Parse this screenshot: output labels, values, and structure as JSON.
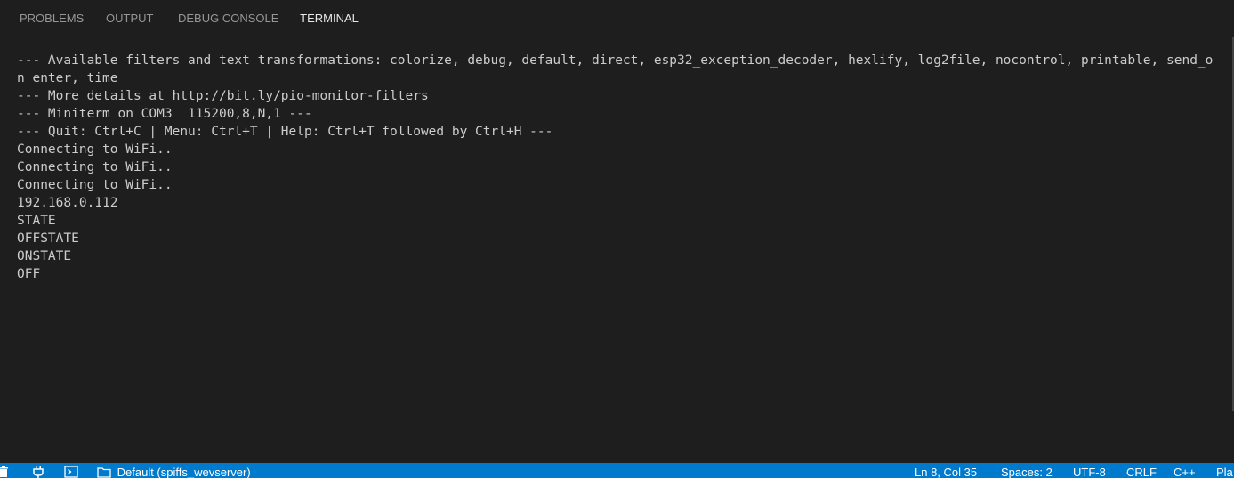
{
  "panel": {
    "tabs": [
      {
        "label": "PROBLEMS",
        "active": false
      },
      {
        "label": "OUTPUT",
        "active": false
      },
      {
        "label": "DEBUG CONSOLE",
        "active": false
      },
      {
        "label": "TERMINAL",
        "active": true
      }
    ]
  },
  "terminal": {
    "lines": [
      "--- Available filters and text transformations: colorize, debug, default, direct, esp32_exception_decoder, hexlify, log2file, nocontrol, printable, send_on_enter, time",
      "--- More details at http://bit.ly/pio-monitor-filters",
      "--- Miniterm on COM3  115200,8,N,1 ---",
      "--- Quit: Ctrl+C | Menu: Ctrl+T | Help: Ctrl+T followed by Ctrl+H ---",
      "Connecting to WiFi..",
      "Connecting to WiFi..",
      "Connecting to WiFi..",
      "192.168.0.112",
      "STATE",
      "OFFSTATE",
      "ONSTATE",
      "OFF"
    ]
  },
  "statusbar": {
    "project_env": "Default (spiffs_wevserver)",
    "cursor_position": "Ln 8, Col 35",
    "indentation": "Spaces: 2",
    "encoding": "UTF-8",
    "line_ending": "CRLF",
    "language": "C++",
    "platform": "Pla",
    "icons": [
      "trash-icon",
      "plug-icon",
      "terminal-icon",
      "folder-icon"
    ]
  },
  "colors": {
    "background": "#1e1e1e",
    "statusbar": "#007acc",
    "terminal_text": "#cccccc",
    "tab_active": "#e7e7e7",
    "tab_inactive": "#969696"
  }
}
